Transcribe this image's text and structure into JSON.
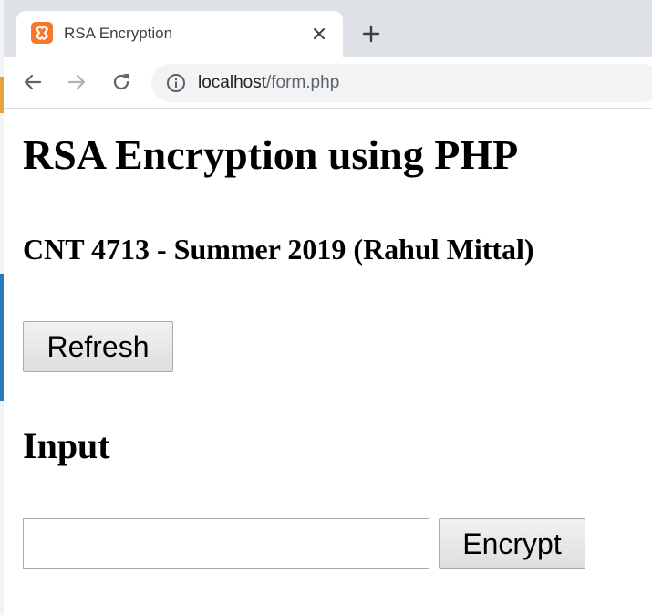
{
  "browser": {
    "tab_title": "RSA Encryption",
    "url_host": "localhost",
    "url_path": "/form.php",
    "favicon": "xampp-icon",
    "accent_favicon": "#f7772d"
  },
  "page": {
    "heading": "RSA Encryption using PHP",
    "subheading": "CNT 4713 - Summer 2019 (Rahul Mittal)",
    "refresh_label": "Refresh",
    "input_heading": "Input",
    "input_value": "",
    "encrypt_label": "Encrypt"
  }
}
